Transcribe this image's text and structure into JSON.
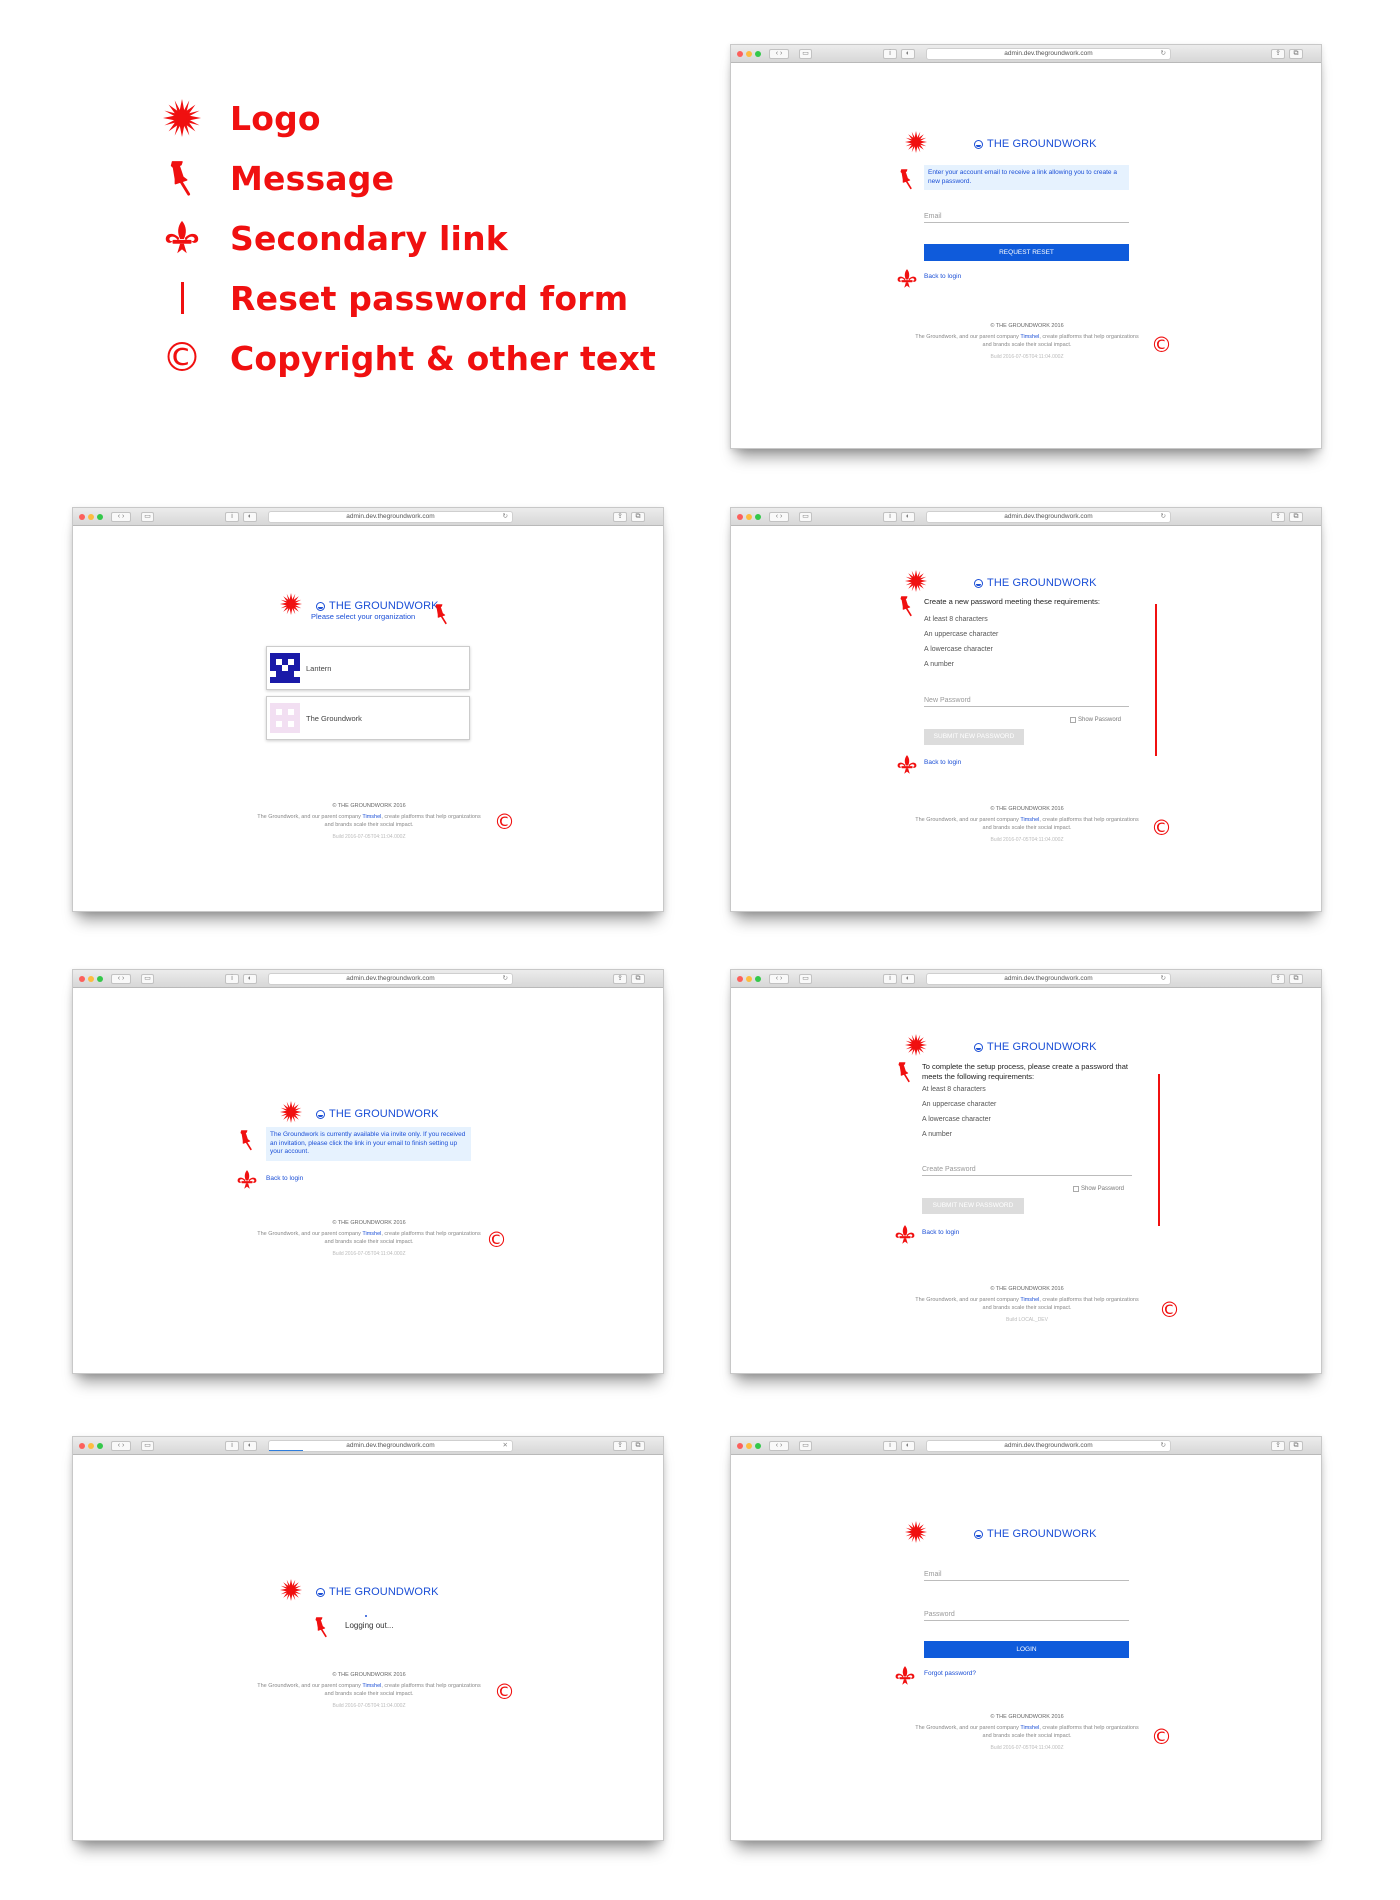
{
  "legend": {
    "items": [
      {
        "icon": "asterisk-icon",
        "label": "Logo"
      },
      {
        "icon": "pushpin-icon",
        "label": "Message"
      },
      {
        "icon": "fleur-de-lis-icon",
        "label": "Secondary link"
      },
      {
        "icon": "vertical-bar-icon",
        "label": "Reset password form"
      },
      {
        "icon": "copyright-icon",
        "label": "Copyright & other text"
      }
    ],
    "color": "#f01010"
  },
  "browser": {
    "url": "admin.dev.thegroundwork.com",
    "reload_glyph": "↻",
    "stop_glyph": "✕"
  },
  "brand": {
    "name": "THE GROUNDWORK",
    "color": "#1b4fd6",
    "button_color": "#0f5bdb"
  },
  "footer": {
    "copyright": "© THE GROUNDWORK 2016",
    "desc_before": "The Groundwork, and our parent company ",
    "desc_link": "Timshel",
    "desc_after": ", create platforms that help organizations and brands scale their social impact.",
    "build": "Build 2016-07-05T04:11:04.000Z",
    "build_local": "Build LOCAL_DEV"
  },
  "screens": {
    "request_reset": {
      "message": "Enter your account email to receive a link allowing you to create a new password.",
      "email_placeholder": "Email",
      "button": "REQUEST RESET",
      "back_link": "Back to login"
    },
    "select_org": {
      "subtitle": "Please select your organization",
      "orgs": [
        "Lantern",
        "The Groundwork"
      ]
    },
    "new_password": {
      "heading": "Create a new password meeting these requirements:",
      "requirements": [
        "At least 8 characters",
        "An uppercase character",
        "A lowercase character",
        "A number"
      ],
      "placeholder": "New Password",
      "show_password": "Show Password",
      "button": "SUBMIT NEW PASSWORD",
      "back_link": "Back to login"
    },
    "invite_only": {
      "message": "The Groundwork is currently available via invite only. If you received an invitation, please click the link in your email to finish setting up your account.",
      "back_link": "Back to login"
    },
    "setup_password": {
      "heading": "To complete the setup process, please create a password that meets the following requirements:",
      "requirements": [
        "At least 8 characters",
        "An uppercase character",
        "A lowercase character",
        "A number"
      ],
      "placeholder": "Create Password",
      "show_password": "Show Password",
      "button": "SUBMIT NEW PASSWORD",
      "back_link": "Back to login"
    },
    "logging_out": {
      "message": "Logging out..."
    },
    "login": {
      "email_placeholder": "Email",
      "password_placeholder": "Password",
      "button": "LOGIN",
      "forgot_link": "Forgot password?"
    }
  }
}
